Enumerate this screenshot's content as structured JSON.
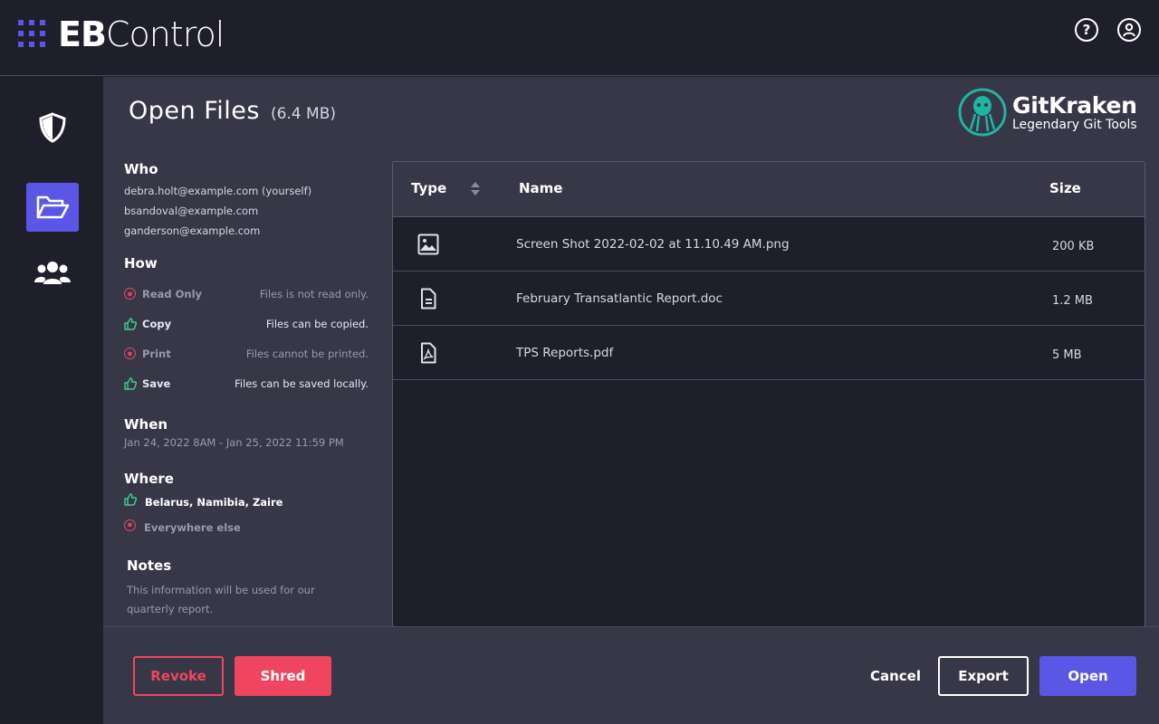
{
  "app": {
    "logo_bold": "EB",
    "logo_light": "Control"
  },
  "header": {
    "help_icon": "?",
    "user_icon": "user-circle"
  },
  "sidebar": {
    "items": [
      {
        "icon": "shield-icon",
        "active": false
      },
      {
        "icon": "folder-open-icon",
        "active": true
      },
      {
        "icon": "users-icon",
        "active": false
      }
    ]
  },
  "page": {
    "title": "Open Files",
    "size": "(6.4 MB)"
  },
  "brand": {
    "name": "GitKraken",
    "tagline": "Legendary Git Tools"
  },
  "who": {
    "heading": "Who",
    "people": [
      "debra.holt@example.com (yourself)",
      "bsandoval@example.com",
      "ganderson@example.com"
    ]
  },
  "how": {
    "heading": "How",
    "rules": [
      {
        "label": "Read Only",
        "desc": "Files is not read only.",
        "allowed": false
      },
      {
        "label": "Copy",
        "desc": "Files can be copied.",
        "allowed": true
      },
      {
        "label": "Print",
        "desc": "Files cannot be printed.",
        "allowed": false
      },
      {
        "label": "Save",
        "desc": "Files can be saved locally.",
        "allowed": true
      }
    ]
  },
  "when": {
    "heading": "When",
    "range": "Jan 24, 2022 8AM - Jan 25, 2022 11:59 PM"
  },
  "where": {
    "heading": "Where",
    "allowed": "Belarus, Namibia, Zaire",
    "denied": "Everywhere else"
  },
  "notes": {
    "heading": "Notes",
    "line1": "This information will be used for our",
    "line2": "quarterly report."
  },
  "table": {
    "col_type": "Type",
    "col_name": "Name",
    "col_size": "Size",
    "rows": [
      {
        "icon": "image-file-icon",
        "name": "Screen Shot 2022-02-02 at 11.10.49 AM.png",
        "size": "200 KB"
      },
      {
        "icon": "document-file-icon",
        "name": "February Transatlantic Report.doc",
        "size": "1.2 MB"
      },
      {
        "icon": "pdf-file-icon",
        "name": "TPS Reports.pdf",
        "size": "5 MB"
      }
    ]
  },
  "footer": {
    "revoke": "Revoke",
    "shred": "Shred",
    "cancel": "Cancel",
    "export": "Export",
    "open": "Open"
  },
  "colors": {
    "accent": "#5b57e6",
    "danger": "#ef4560",
    "success": "#3ecf8e",
    "background": "#1f1f2b",
    "panel": "#373748"
  }
}
